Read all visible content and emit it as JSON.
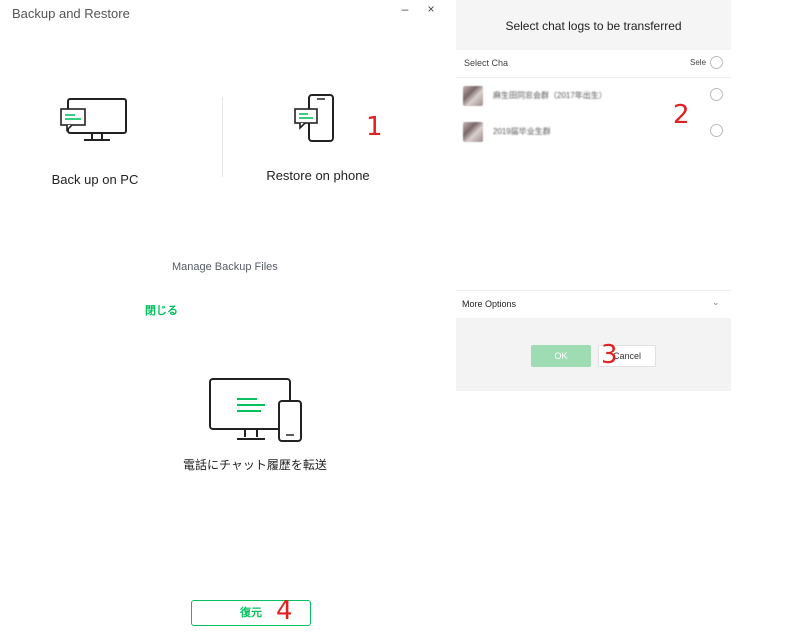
{
  "window": {
    "title": "Backup and Restore",
    "minimize_glyph": "–",
    "close_glyph": "×"
  },
  "options": {
    "backup_pc": {
      "label": "Back up on PC",
      "icon": "monitor-chat-icon"
    },
    "restore_phone": {
      "label": "Restore on phone",
      "icon": "phone-chat-icon"
    }
  },
  "links": {
    "manage_backup": "Manage Backup Files",
    "close": "閉じる"
  },
  "transfer": {
    "label": "電話にチャット履歴を転送",
    "icon": "desktop-phone-transfer-icon"
  },
  "restore_button": "復元",
  "right_panel": {
    "header": "Select chat logs to be transferred",
    "list_header": "Select Cha",
    "select_all": "Sele",
    "chats": [
      {
        "name": "麻生田同窓会群（2017年出生）"
      },
      {
        "name": "2019届毕业生群"
      }
    ],
    "more_options": "More Options",
    "more_options_chevron": "⌄",
    "ok": "OK",
    "cancel": "Cancel"
  },
  "annotations": [
    "1",
    "2",
    "3",
    "4"
  ],
  "colors": {
    "accent_green": "#07c160",
    "ok_disabled": "#9fdcb3",
    "annotation_red": "#e02020",
    "panel_gray": "#f5f5f5"
  }
}
